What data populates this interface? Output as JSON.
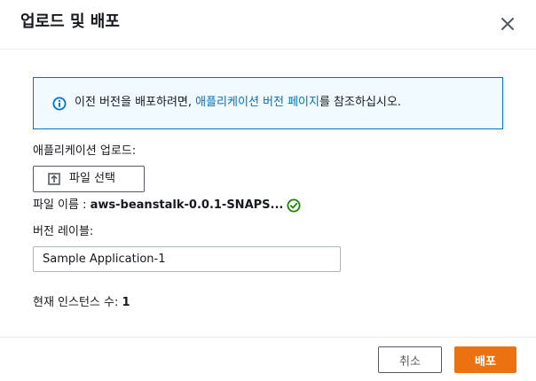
{
  "dialog": {
    "title": "업로드 및 배포",
    "close_icon": "close-icon"
  },
  "info": {
    "icon": "info-icon",
    "text_before": "이전 버전을 배포하려면, ",
    "link_text": "애플리케이션 버전 페이지",
    "text_after": "를 참조하십시오.",
    "border_color": "#0073bb",
    "background_color": "#f1faff"
  },
  "upload": {
    "label": "애플리케이션 업로드:",
    "button_label": "파일 선택",
    "button_icon": "upload-icon",
    "filename_label": "파일 이름 : ",
    "filename_value": "aws-beanstalk-0.0.1-SNAPS...",
    "status_icon": "check-circle-icon",
    "status_color": "#1d8102"
  },
  "version": {
    "label": "버전 레이블:",
    "value": "Sample Application-1"
  },
  "instances": {
    "label": "현재 인스턴스 수: ",
    "value": "1"
  },
  "footer": {
    "cancel_label": "취소",
    "deploy_label": "배포",
    "accent_color": "#ec7211"
  }
}
